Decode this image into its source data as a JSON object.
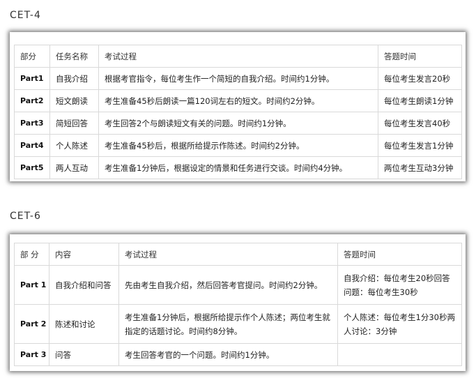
{
  "cet4": {
    "title": "CET-4",
    "headers": [
      "部分",
      "任务名称",
      "考试过程",
      "答题时间"
    ],
    "rows": [
      [
        "Part1",
        "自我介绍",
        "根据考官指令，每位考生作一个简短的自我介绍。时间约1分钟。",
        "每位考生发言20秒"
      ],
      [
        "Part2",
        "短文朗读",
        "考生准备45秒后朗读一篇120词左右的短文。时间约2分钟。",
        "每位考生朗读1分钟"
      ],
      [
        "Part3",
        "简短回答",
        "考生回答2个与朗读短文有关的问题。时间约1分钟。",
        "每位考生发言40秒"
      ],
      [
        "Part4",
        "个人陈述",
        "考生准备45秒后，根据所给提示作陈述。时间约2分钟。",
        "每位考生发言1分钟"
      ],
      [
        "Part5",
        "两人互动",
        "考生准备1分钟后，根据设定的情景和任务进行交谈。时间约4分钟。",
        "两位考生互动3分钟"
      ]
    ]
  },
  "cet6": {
    "title": "CET-6",
    "headers": [
      "部 分",
      "内容",
      "考试过程",
      "答题时间"
    ],
    "rows": [
      [
        "Part 1",
        "自我介绍和问答",
        "先由考生自我介绍，然后回答考官提问。时间约2分钟。",
        "自我介绍：每位考生20秒回答问题：每位考生30秒"
      ],
      [
        "Part 2",
        "陈述和讨论",
        "考生准备1分钟后，根据所给提示作个人陈述；两位考生就指定的话题讨论。时间约8分钟。",
        "个人陈述：每位考生1分30秒两人讨论：3分钟"
      ],
      [
        "Part 3",
        "问答",
        "考生回答考官的一个问题。时间约1分钟。",
        ""
      ]
    ]
  }
}
